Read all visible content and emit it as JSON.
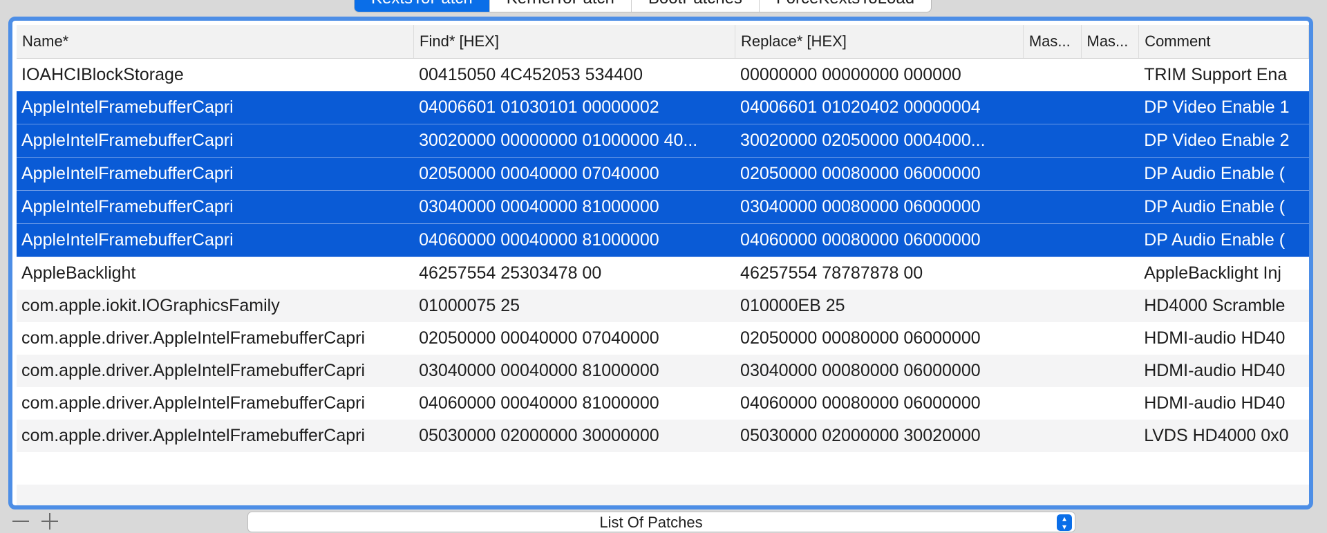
{
  "tabs": [
    {
      "label": "KextsToPatch",
      "active": true
    },
    {
      "label": "KernelToPatch",
      "active": false
    },
    {
      "label": "BootPatches",
      "active": false
    },
    {
      "label": "ForceKextsToLoad",
      "active": false
    }
  ],
  "table": {
    "columns": [
      "Name*",
      "Find* [HEX]",
      "Replace* [HEX]",
      "Mas...",
      "Mas...",
      "Comment"
    ],
    "rows": [
      {
        "cells": [
          "IOAHCIBlockStorage",
          "00415050 4C452053 534400",
          "00000000 00000000 000000",
          "",
          "",
          "TRIM Support Ena"
        ],
        "selected": false
      },
      {
        "cells": [
          "AppleIntelFramebufferCapri",
          "04006601 01030101 00000002",
          "04006601 01020402 00000004",
          "",
          "",
          "DP Video Enable 1"
        ],
        "selected": true
      },
      {
        "cells": [
          "AppleIntelFramebufferCapri",
          "30020000 00000000 01000000 40...",
          "30020000 02050000 0004000...",
          "",
          "",
          "DP Video Enable 2"
        ],
        "selected": true
      },
      {
        "cells": [
          "AppleIntelFramebufferCapri",
          "02050000 00040000 07040000",
          "02050000 00080000 06000000",
          "",
          "",
          "DP Audio Enable ("
        ],
        "selected": true
      },
      {
        "cells": [
          "AppleIntelFramebufferCapri",
          "03040000 00040000 81000000",
          "03040000 00080000 06000000",
          "",
          "",
          "DP Audio Enable ("
        ],
        "selected": true
      },
      {
        "cells": [
          "AppleIntelFramebufferCapri",
          "04060000 00040000 81000000",
          "04060000 00080000 06000000",
          "",
          "",
          "DP Audio Enable ("
        ],
        "selected": true
      },
      {
        "cells": [
          "AppleBacklight",
          "46257554 25303478 00",
          "46257554 78787878 00",
          "",
          "",
          "AppleBacklight Inj"
        ],
        "selected": false
      },
      {
        "cells": [
          "com.apple.iokit.IOGraphicsFamily",
          "01000075 25",
          "010000EB 25",
          "",
          "",
          "HD4000 Scramble"
        ],
        "selected": false
      },
      {
        "cells": [
          "com.apple.driver.AppleIntelFramebufferCapri",
          "02050000 00040000 07040000",
          "02050000 00080000 06000000",
          "",
          "",
          "HDMI-audio HD40"
        ],
        "selected": false
      },
      {
        "cells": [
          "com.apple.driver.AppleIntelFramebufferCapri",
          "03040000 00040000 81000000",
          "03040000 00080000 06000000",
          "",
          "",
          "HDMI-audio HD40"
        ],
        "selected": false
      },
      {
        "cells": [
          "com.apple.driver.AppleIntelFramebufferCapri",
          "04060000 00040000 81000000",
          "04060000 00080000 06000000",
          "",
          "",
          "HDMI-audio HD40"
        ],
        "selected": false
      },
      {
        "cells": [
          "com.apple.driver.AppleIntelFramebufferCapri",
          "05030000 02000000 30000000",
          "05030000 02000000 30020000",
          "",
          "",
          "LVDS HD4000 0x0"
        ],
        "selected": false
      },
      {
        "cells": [
          "",
          "",
          "",
          "",
          "",
          ""
        ],
        "selected": false
      },
      {
        "cells": [
          "",
          "",
          "",
          "",
          "",
          ""
        ],
        "selected": false
      }
    ]
  },
  "footer": {
    "popup_label": "List Of Patches",
    "remove_icon": "minus-icon",
    "add_icon": "plus-icon",
    "chevron_icon": "up-down-chevron-icon"
  },
  "colors": {
    "accent": "#0a6ee8",
    "selection": "#0a5bd6",
    "focus_ring": "#4d8ee6"
  }
}
